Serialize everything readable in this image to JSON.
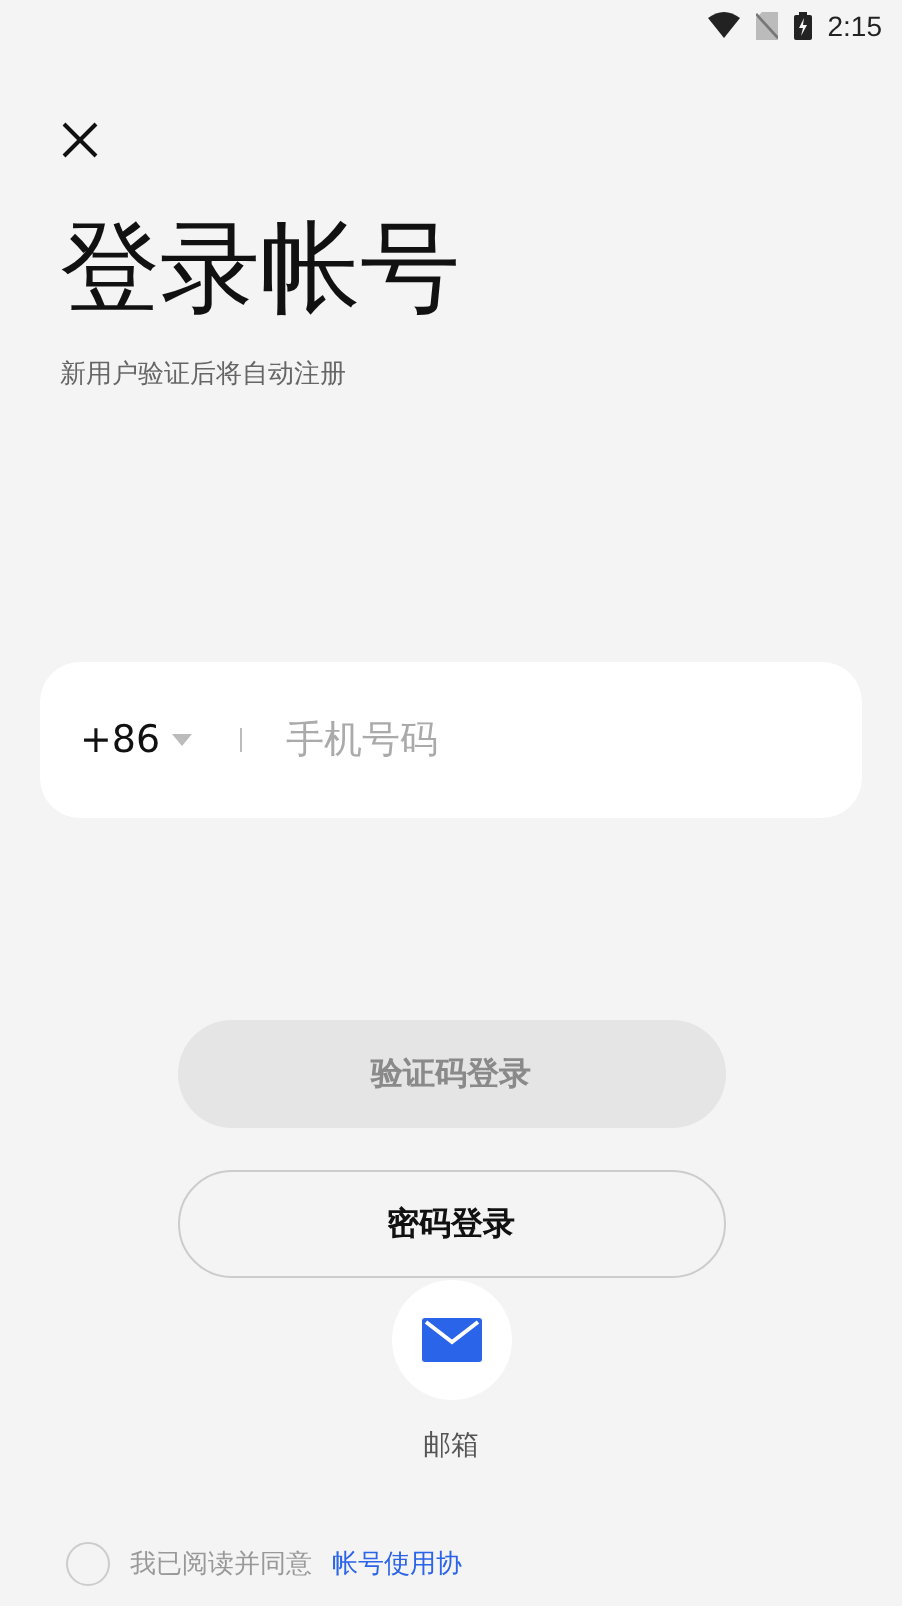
{
  "status_bar": {
    "time": "2:15"
  },
  "title": "登录帐号",
  "subtitle": "新用户验证后将自动注册",
  "phone": {
    "country_code": "+86",
    "placeholder": "手机号码"
  },
  "buttons": [
    {
      "label": "验证码登录",
      "disabled": true
    },
    {
      "label": "密码登录",
      "disabled": false
    }
  ],
  "alt_login": {
    "label": "邮箱"
  },
  "agreement": {
    "checked": false,
    "text": "我已阅读并同意",
    "link": "帐号使用协"
  }
}
